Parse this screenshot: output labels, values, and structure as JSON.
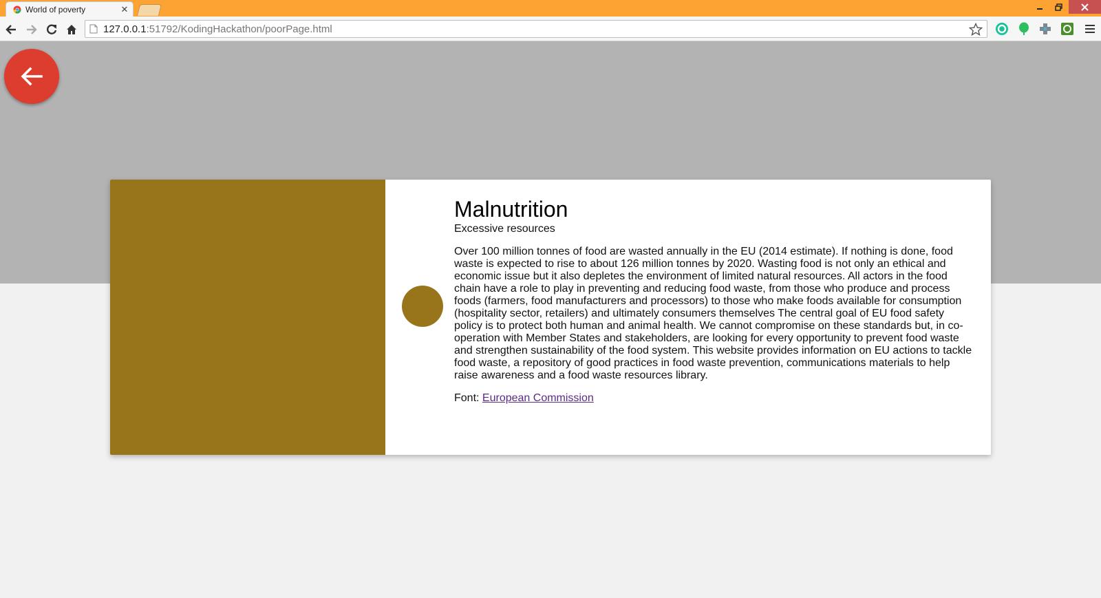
{
  "browser": {
    "tab_title": "World of poverty",
    "url_host": "127.0.0.1",
    "url_rest": ":51792/KodingHackathon/poorPage.html"
  },
  "card": {
    "title": "Malnutrition",
    "subtitle": "Excessive resources",
    "body": "Over 100 million tonnes of food are wasted annually in the EU (2014 estimate). If nothing is done, food waste is expected to rise to about 126 million tonnes by 2020. Wasting food is not only an ethical and economic issue but it also depletes the environment of limited natural resources. All actors in the food chain have a role to play in preventing and reducing food waste, from those who produce and process foods (farmers, food manufacturers and processors) to those who make foods available for consumption (hospitality sector, retailers) and ultimately consumers themselves The central goal of EU food safety policy is to protect both human and animal health. We cannot compromise on these standards but, in co-operation with Member States and stakeholders, are looking for every opportunity to prevent food waste and strengthen sustainability of the food system. This website provides information on EU actions to tackle food waste, a repository of good practices in food waste prevention, communications materials to help raise awareness and a food waste resources library.",
    "source_label": "Font:",
    "source_link": "European Commission"
  },
  "colors": {
    "titlebar": "#fda334",
    "accent_gold": "#98741a",
    "back_button": "#dc3d2f",
    "hero_band": "#b3b3b3",
    "page_bg": "#f1f1f1"
  },
  "icons": {
    "back_button": "arrow-left-icon"
  }
}
